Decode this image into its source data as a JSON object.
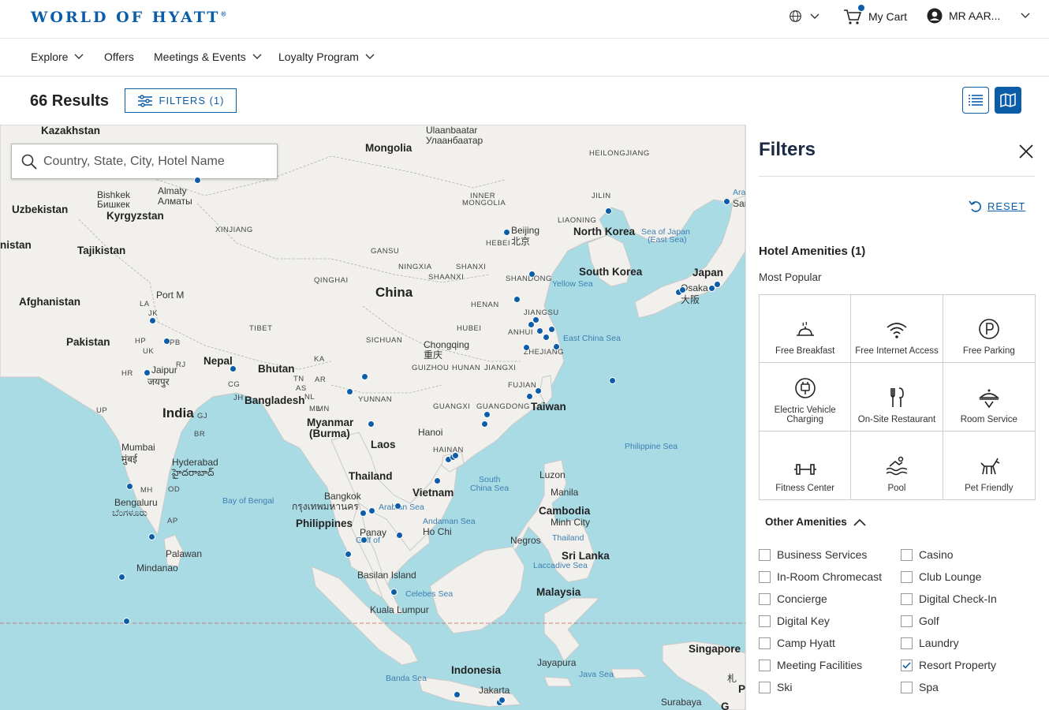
{
  "header": {
    "logo": "WORLD OF HYATT",
    "logo_mark": "®",
    "cart_label": "My Cart",
    "user_label": "MR AAR..."
  },
  "nav": {
    "items": [
      {
        "label": "Explore",
        "dropdown": true
      },
      {
        "label": "Offers",
        "dropdown": false
      },
      {
        "label": "Meetings & Events",
        "dropdown": true
      },
      {
        "label": "Loyalty Program",
        "dropdown": true
      }
    ]
  },
  "results": {
    "count_label": "66 Results",
    "filters_label": "FILTERS (1)"
  },
  "search": {
    "placeholder": "Country, State, City, Hotel Name"
  },
  "map": {
    "labels": [
      {
        "text": "Kazakhstan",
        "cls": "med"
      },
      {
        "text": "Mongolia",
        "cls": "med"
      },
      {
        "text": "Ulaanbaatar",
        "cls": "city"
      },
      {
        "text": "Улаанбаатар",
        "cls": "city"
      },
      {
        "text": "HEILONGJIANG",
        "cls": "sm"
      },
      {
        "text": "Bishkek",
        "cls": "city"
      },
      {
        "text": "Бишкек",
        "cls": "city"
      },
      {
        "text": "Almaty",
        "cls": "city"
      },
      {
        "text": "Алматы",
        "cls": "city"
      },
      {
        "text": "Uzbekistan",
        "cls": "med"
      },
      {
        "text": "Kyrgyzstan",
        "cls": "med"
      },
      {
        "text": "XINJIANG",
        "cls": "sm"
      },
      {
        "text": "INNER",
        "cls": "sm"
      },
      {
        "text": "MONGOLIA",
        "cls": "sm"
      },
      {
        "text": "JILIN",
        "cls": "sm"
      },
      {
        "text": "LIAONING",
        "cls": "sm"
      },
      {
        "text": "Beijing",
        "cls": "city"
      },
      {
        "text": "北京",
        "cls": "city"
      },
      {
        "text": "HEBEI",
        "cls": "sm"
      },
      {
        "text": "North Korea",
        "cls": "med"
      },
      {
        "text": "Sea of Japan",
        "cls": "sea"
      },
      {
        "text": "(East Sea)",
        "cls": "sea"
      },
      {
        "text": "nistan",
        "cls": "med"
      },
      {
        "text": "Tajikistan",
        "cls": "med"
      },
      {
        "text": "GANSU",
        "cls": "sm"
      },
      {
        "text": "NINGXIA",
        "cls": "sm"
      },
      {
        "text": "SHANXI",
        "cls": "sm"
      },
      {
        "text": "SHAANXI",
        "cls": "sm"
      },
      {
        "text": "QINGHAI",
        "cls": "sm"
      },
      {
        "text": "SHANDONG",
        "cls": "sm"
      },
      {
        "text": "South Korea",
        "cls": "med"
      },
      {
        "text": "Yellow Sea",
        "cls": "sea"
      },
      {
        "text": "Japan",
        "cls": "med"
      },
      {
        "text": "Osaka",
        "cls": "city"
      },
      {
        "text": "大阪",
        "cls": "city"
      },
      {
        "text": "Afghanistan",
        "cls": "med"
      },
      {
        "text": "China",
        "cls": "big"
      },
      {
        "text": "HENAN",
        "cls": "sm"
      },
      {
        "text": "JIANGSU",
        "cls": "sm"
      },
      {
        "text": "TIBET",
        "cls": "sm"
      },
      {
        "text": "HUBEI",
        "cls": "sm"
      },
      {
        "text": "ANHUI",
        "cls": "sm"
      },
      {
        "text": "Pakistan",
        "cls": "med"
      },
      {
        "text": "SICHUAN",
        "cls": "sm"
      },
      {
        "text": "Chongqing",
        "cls": "city"
      },
      {
        "text": "重庆",
        "cls": "city"
      },
      {
        "text": "East China Sea",
        "cls": "sea"
      },
      {
        "text": "ZHEJIANG",
        "cls": "sm"
      },
      {
        "text": "Nepal",
        "cls": "med"
      },
      {
        "text": "Bhutan",
        "cls": "med"
      },
      {
        "text": "GUIZHOU",
        "cls": "sm"
      },
      {
        "text": "HUNAN",
        "cls": "sm"
      },
      {
        "text": "JIANGXI",
        "cls": "sm"
      },
      {
        "text": "Jaipur",
        "cls": "city"
      },
      {
        "text": "जयपुर",
        "cls": "city"
      },
      {
        "text": "Bangladesh",
        "cls": "med"
      },
      {
        "text": "YUNNAN",
        "cls": "sm"
      },
      {
        "text": "FUJIAN",
        "cls": "sm"
      },
      {
        "text": "GUANGXI",
        "cls": "sm"
      },
      {
        "text": "GUANGDONG",
        "cls": "sm"
      },
      {
        "text": "Taiwan",
        "cls": "med"
      },
      {
        "text": "India",
        "cls": "big"
      },
      {
        "text": "Myanmar",
        "cls": "med"
      },
      {
        "text": "(Burma)",
        "cls": "med"
      },
      {
        "text": "Hanoi",
        "cls": "city"
      },
      {
        "text": "Philippine Sea",
        "cls": "sea"
      },
      {
        "text": "Mumbai",
        "cls": "city"
      },
      {
        "text": "मुंबई",
        "cls": "city"
      },
      {
        "text": "Laos",
        "cls": "med"
      },
      {
        "text": "HAINAN",
        "cls": "sm"
      },
      {
        "text": "Hyderabad",
        "cls": "city"
      },
      {
        "text": "హైదరాబాద్",
        "cls": "city"
      },
      {
        "text": "Thailand",
        "cls": "med"
      },
      {
        "text": "Luzon",
        "cls": "city"
      },
      {
        "text": "South",
        "cls": "sea"
      },
      {
        "text": "China Sea",
        "cls": "sea"
      },
      {
        "text": "Bengaluru",
        "cls": "city"
      },
      {
        "text": "ಬೆಂಗಳೂರು",
        "cls": "city"
      },
      {
        "text": "Bay of Bengal",
        "cls": "sea"
      },
      {
        "text": "Bangkok",
        "cls": "city"
      },
      {
        "text": "กรุงเทพมหานคร",
        "cls": "city"
      },
      {
        "text": "Vietnam",
        "cls": "med"
      },
      {
        "text": "Manila",
        "cls": "city"
      },
      {
        "text": "Arabian Sea",
        "cls": "sea"
      },
      {
        "text": "Cambodia",
        "cls": "med"
      },
      {
        "text": "Philippines",
        "cls": "med"
      },
      {
        "text": "Andaman Sea",
        "cls": "sea"
      },
      {
        "text": "Ho Chi",
        "cls": "city"
      },
      {
        "text": "Minh City",
        "cls": "city"
      },
      {
        "text": "Panay",
        "cls": "city"
      },
      {
        "text": "Gulf of",
        "cls": "sea"
      },
      {
        "text": "Thailand",
        "cls": "sea"
      },
      {
        "text": "Negros",
        "cls": "city"
      },
      {
        "text": "Palawan",
        "cls": "city"
      },
      {
        "text": "Sri Lanka",
        "cls": "med"
      },
      {
        "text": "Mindanao",
        "cls": "city"
      },
      {
        "text": "Laccadive Sea",
        "cls": "sea"
      },
      {
        "text": "Basilan Island",
        "cls": "city"
      },
      {
        "text": "Malaysia",
        "cls": "med"
      },
      {
        "text": "Celebes Sea",
        "cls": "sea"
      },
      {
        "text": "Kuala Lumpur",
        "cls": "city"
      },
      {
        "text": "Singapore",
        "cls": "med"
      },
      {
        "text": "Jayapura",
        "cls": "city"
      },
      {
        "text": "Indonesia",
        "cls": "med"
      },
      {
        "text": "Java Sea",
        "cls": "sea"
      },
      {
        "text": "Banda Sea",
        "cls": "sea"
      },
      {
        "text": "Jakarta",
        "cls": "city"
      },
      {
        "text": "Surabaya",
        "cls": "city"
      },
      {
        "text": "Arafura Sea",
        "cls": "sea"
      },
      {
        "text": "Sar",
        "cls": "city"
      },
      {
        "text": "札",
        "cls": "city"
      },
      {
        "text": "Pap",
        "cls": "med"
      },
      {
        "text": "G",
        "cls": "med"
      },
      {
        "text": "Port M",
        "cls": "city"
      },
      {
        "text": "LA",
        "cls": "sm"
      },
      {
        "text": "JK",
        "cls": "sm"
      },
      {
        "text": "HP",
        "cls": "sm"
      },
      {
        "text": "PB",
        "cls": "sm"
      },
      {
        "text": "UK",
        "cls": "sm"
      },
      {
        "text": "HR",
        "cls": "sm"
      },
      {
        "text": "RJ",
        "cls": "sm"
      },
      {
        "text": "UP",
        "cls": "sm"
      },
      {
        "text": "GJ",
        "cls": "sm"
      },
      {
        "text": "CG",
        "cls": "sm"
      },
      {
        "text": "JH",
        "cls": "sm"
      },
      {
        "text": "BR",
        "cls": "sm"
      },
      {
        "text": "OD",
        "cls": "sm"
      },
      {
        "text": "MH",
        "cls": "sm"
      },
      {
        "text": "AP",
        "cls": "sm"
      },
      {
        "text": "KA",
        "cls": "sm"
      },
      {
        "text": "TN",
        "cls": "sm"
      },
      {
        "text": "AR",
        "cls": "sm"
      },
      {
        "text": "AS",
        "cls": "sm"
      },
      {
        "text": "NL",
        "cls": "sm"
      },
      {
        "text": "ML",
        "cls": "sm"
      },
      {
        "text": "MN",
        "cls": "sm"
      },
      {
        "text": "MZ",
        "cls": "sm"
      },
      {
        "text": "TR",
        "cls": "sm"
      }
    ]
  },
  "panel": {
    "title": "Filters",
    "reset_label": "RESET",
    "amenities_title": "Hotel Amenities (1)",
    "popular_label": "Most Popular",
    "popular": [
      {
        "label": "Free Breakfast",
        "icon": "breakfast-icon"
      },
      {
        "label": "Free Internet Access",
        "icon": "wifi-icon"
      },
      {
        "label": "Free Parking",
        "icon": "parking-icon"
      },
      {
        "label": "Electric Vehicle Charging",
        "icon": "ev-charging-icon"
      },
      {
        "label": "On-Site Restaurant",
        "icon": "restaurant-icon"
      },
      {
        "label": "Room Service",
        "icon": "room-service-icon"
      },
      {
        "label": "Fitness Center",
        "icon": "fitness-icon"
      },
      {
        "label": "Pool",
        "icon": "pool-icon"
      },
      {
        "label": "Pet Friendly",
        "icon": "pet-icon"
      }
    ],
    "other_title": "Other Amenities",
    "other": [
      {
        "label": "Business Services",
        "checked": false
      },
      {
        "label": "Casino",
        "checked": false
      },
      {
        "label": "In-Room Chromecast",
        "checked": false
      },
      {
        "label": "Club Lounge",
        "checked": false
      },
      {
        "label": "Concierge",
        "checked": false
      },
      {
        "label": "Digital Check-In",
        "checked": false
      },
      {
        "label": "Digital Key",
        "checked": false
      },
      {
        "label": "Golf",
        "checked": false
      },
      {
        "label": "Camp Hyatt",
        "checked": false
      },
      {
        "label": "Laundry",
        "checked": false
      },
      {
        "label": "Meeting Facilities",
        "checked": false
      },
      {
        "label": "Resort Property",
        "checked": true
      },
      {
        "label": "Ski",
        "checked": false
      },
      {
        "label": "Spa",
        "checked": false
      }
    ]
  },
  "colors": {
    "brand": "#0b5da8",
    "water": "#a9dbe5",
    "land": "#f1f0ec"
  }
}
